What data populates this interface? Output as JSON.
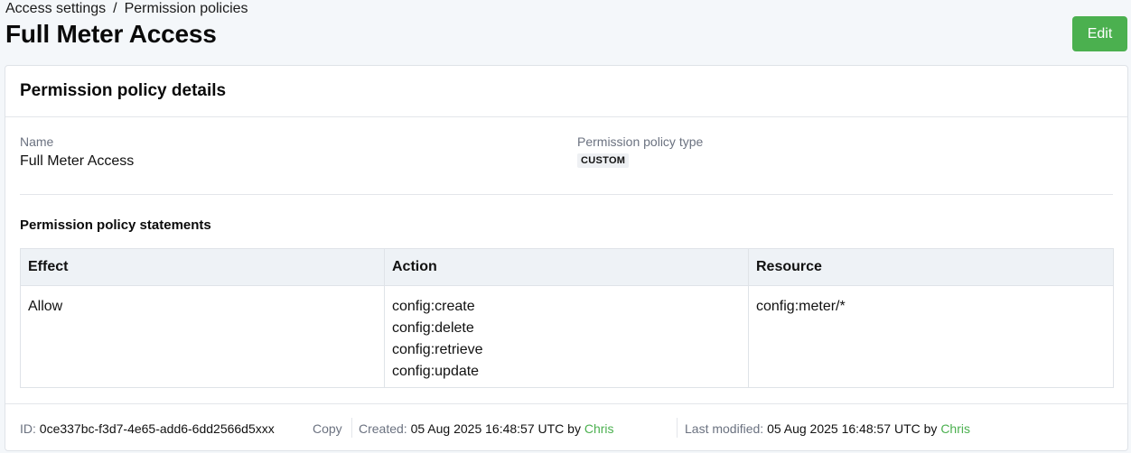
{
  "breadcrumb": {
    "items": [
      "Access settings",
      "Permission policies"
    ],
    "separator": "/"
  },
  "page": {
    "title": "Full Meter Access",
    "edit_label": "Edit"
  },
  "card": {
    "title": "Permission policy details",
    "name_label": "Name",
    "name_value": "Full Meter Access",
    "type_label": "Permission policy type",
    "type_badge": "CUSTOM",
    "statements_title": "Permission policy statements"
  },
  "table": {
    "headers": [
      "Effect",
      "Action",
      "Resource"
    ],
    "rows": [
      {
        "effect": "Allow",
        "actions": [
          "config:create",
          "config:delete",
          "config:retrieve",
          "config:update"
        ],
        "resource": "config:meter/*"
      }
    ]
  },
  "footer": {
    "id_label": "ID:",
    "id_value": "0ce337bc-f3d7-4e65-add6-6dd2566d5xxx",
    "copy_label": "Copy",
    "created_label": "Created:",
    "created_value": "05 Aug 2025 16:48:57 UTC by",
    "created_by": "Chris",
    "modified_label": "Last modified:",
    "modified_value": "05 Aug 2025 16:48:57 UTC by",
    "modified_by": "Chris"
  },
  "colors": {
    "accent": "#4bb04f",
    "background": "#f4f7fa"
  }
}
